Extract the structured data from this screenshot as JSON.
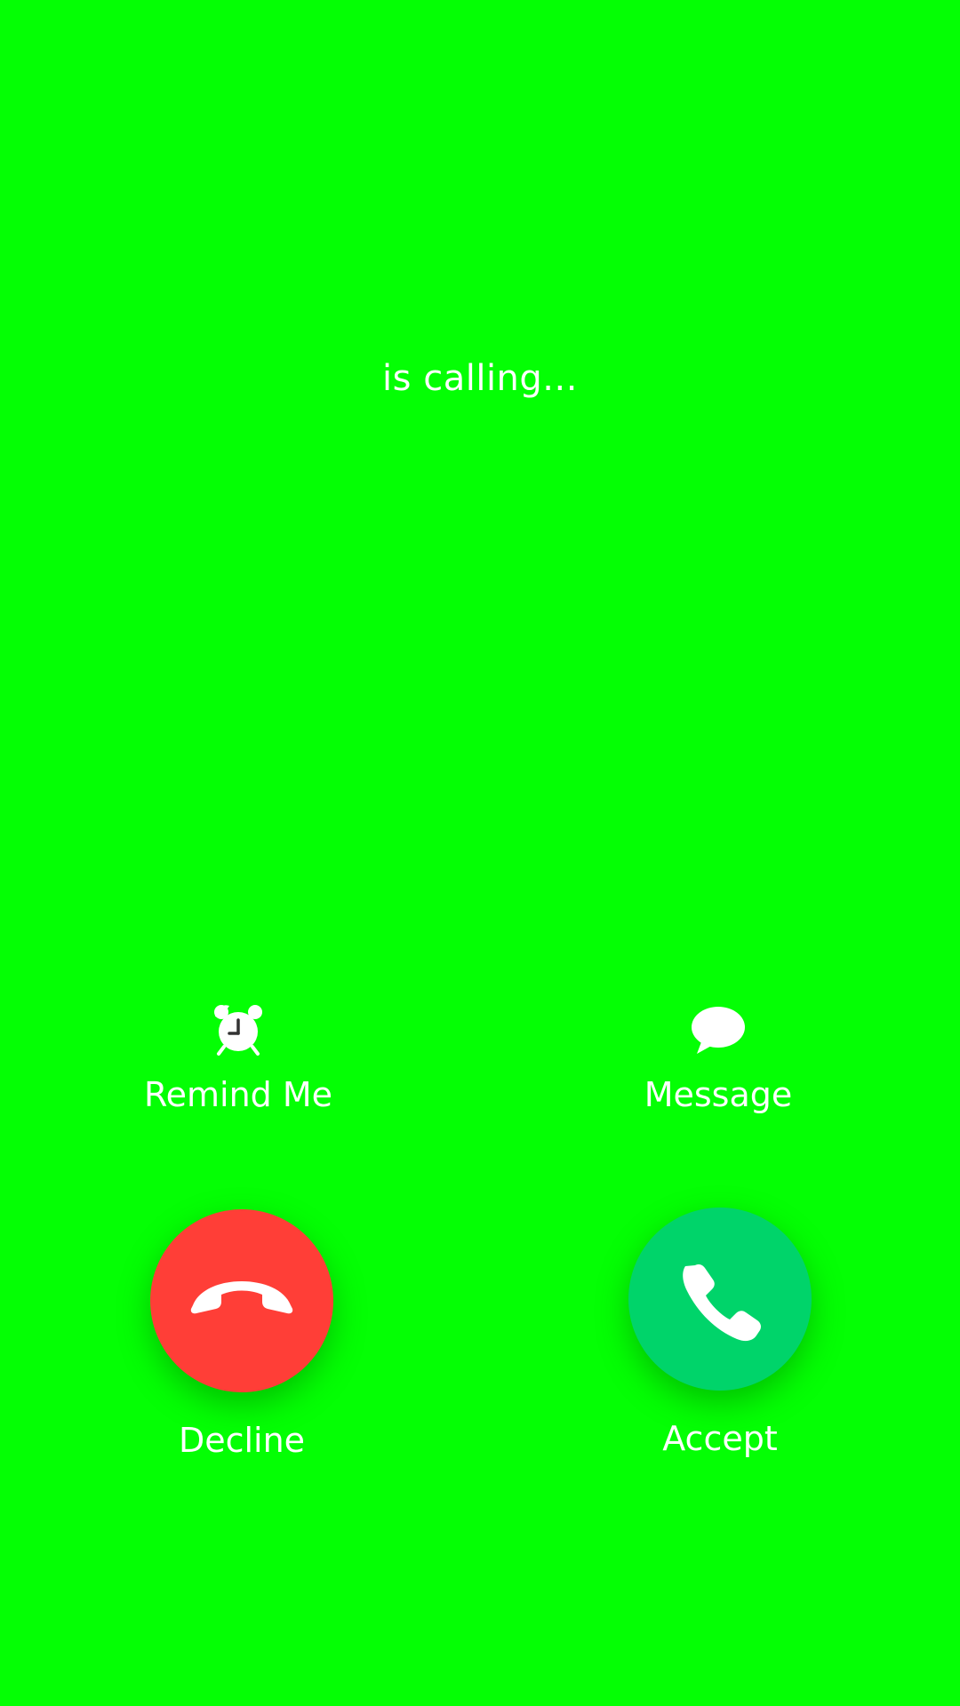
{
  "screen": {
    "background_color": "#04ff04",
    "status_text": "is calling..."
  },
  "options": {
    "remind": {
      "label": "Remind Me",
      "icon": "alarm-clock-icon"
    },
    "message": {
      "label": "Message",
      "icon": "speech-bubble-icon"
    }
  },
  "actions": {
    "decline": {
      "label": "Decline",
      "icon": "phone-hangup-icon",
      "color": "#ff3e37"
    },
    "accept": {
      "label": "Accept",
      "icon": "phone-icon",
      "color": "#00d46a"
    }
  }
}
